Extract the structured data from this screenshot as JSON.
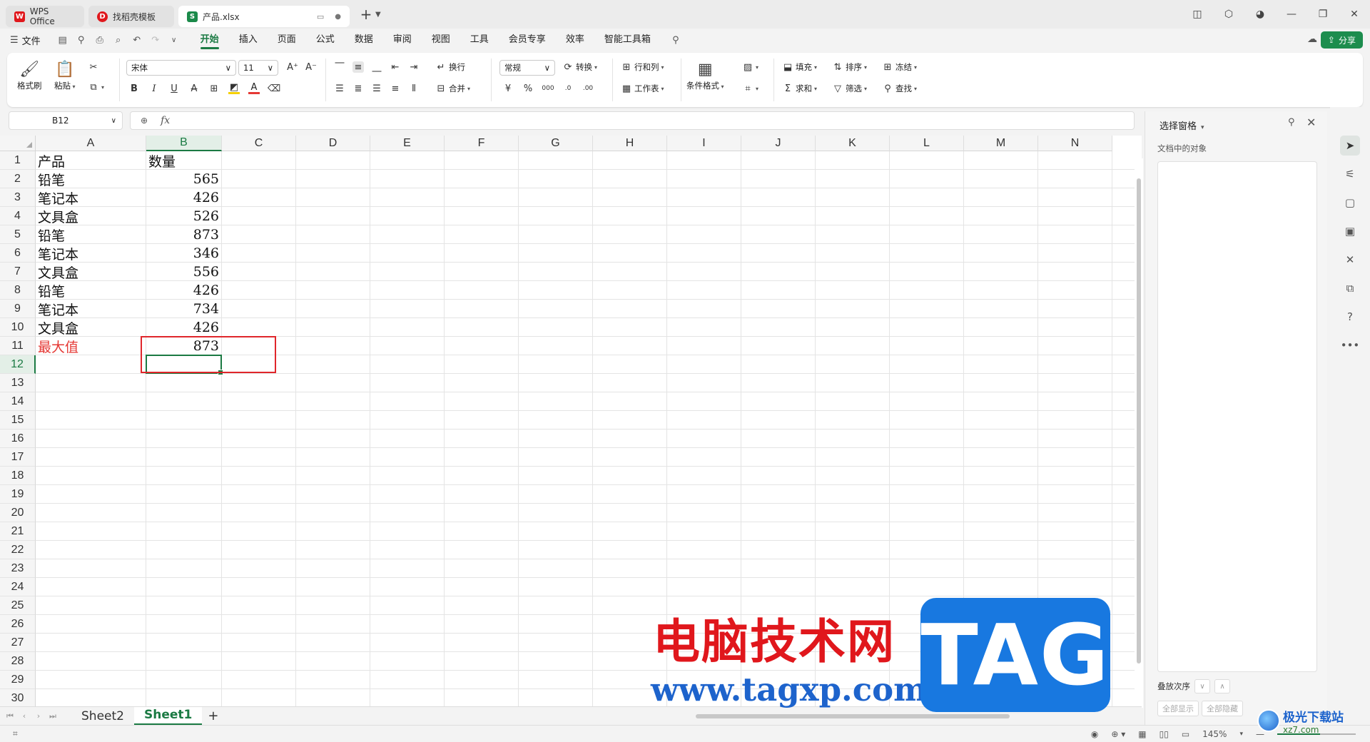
{
  "titlebar": {
    "tabs": [
      {
        "label": "WPS Office",
        "color": "#e0171c"
      },
      {
        "label": "找稻壳模板",
        "color": "#e0171c"
      },
      {
        "label": "产品.xlsx",
        "color": "#1b8a4a",
        "logo": "S"
      }
    ]
  },
  "menubar": {
    "file": "文件",
    "items": [
      "开始",
      "插入",
      "页面",
      "公式",
      "数据",
      "审阅",
      "视图",
      "工具",
      "会员专享",
      "效率",
      "智能工具箱"
    ],
    "active": "开始",
    "share": "分享"
  },
  "ribbon": {
    "format_painter": "格式刷",
    "paste": "粘贴",
    "font_name": "宋体",
    "font_size": "11",
    "wrap": "换行",
    "merge": "合并",
    "number_format": "常规",
    "convert": "转换",
    "row_col": "行和列",
    "worksheet": "工作表",
    "cond_format": "条件格式",
    "fill": "填充",
    "sort": "排序",
    "freeze": "冻结",
    "sum": "求和",
    "filter": "筛选",
    "find": "查找",
    "font_color": "#e53935",
    "highlight_color": "#f5d000"
  },
  "formula_bar": {
    "name_box": "B12",
    "fx": "fx",
    "formula": ""
  },
  "grid": {
    "columns": [
      "A",
      "B",
      "C",
      "D",
      "E",
      "F",
      "G",
      "H",
      "I",
      "J",
      "K",
      "L",
      "M",
      "N"
    ],
    "selected_column": "B",
    "rows": [
      "1",
      "2",
      "3",
      "4",
      "5",
      "6",
      "7",
      "8",
      "9",
      "10",
      "11",
      "12",
      "13",
      "14",
      "15",
      "16",
      "17",
      "18",
      "19",
      "20",
      "21",
      "22",
      "23",
      "24",
      "25",
      "26",
      "27",
      "28",
      "29",
      "30"
    ],
    "selected_row": "12",
    "data": [
      {
        "a": "产品",
        "b": ""
      },
      {
        "a": "铅笔",
        "b": "565"
      },
      {
        "a": "笔记本",
        "b": "426"
      },
      {
        "a": "文具盒",
        "b": "526"
      },
      {
        "a": "铅笔",
        "b": "873"
      },
      {
        "a": "笔记本",
        "b": "346"
      },
      {
        "a": "文具盒",
        "b": "556"
      },
      {
        "a": "铅笔",
        "b": "426"
      },
      {
        "a": "笔记本",
        "b": "734"
      },
      {
        "a": "文具盒",
        "b": "426"
      },
      {
        "a": "最大值",
        "b": "873"
      }
    ],
    "header_b": "数量"
  },
  "sheets": {
    "tabs": [
      "Sheet2",
      "Sheet1"
    ],
    "active": "Sheet1",
    "add": "+"
  },
  "status": {
    "zoom": "145%"
  },
  "pane": {
    "title": "选择窗格",
    "subtitle": "文档中的对象",
    "order_label": "叠放次序",
    "show_all": "全部显示",
    "hide_all": "全部隐藏"
  },
  "watermark": {
    "cn": "电脑技术网",
    "url": "www.tagxp.com",
    "tag": "TAG",
    "site_name": "极光下载站",
    "site_url": "xz7.com"
  }
}
